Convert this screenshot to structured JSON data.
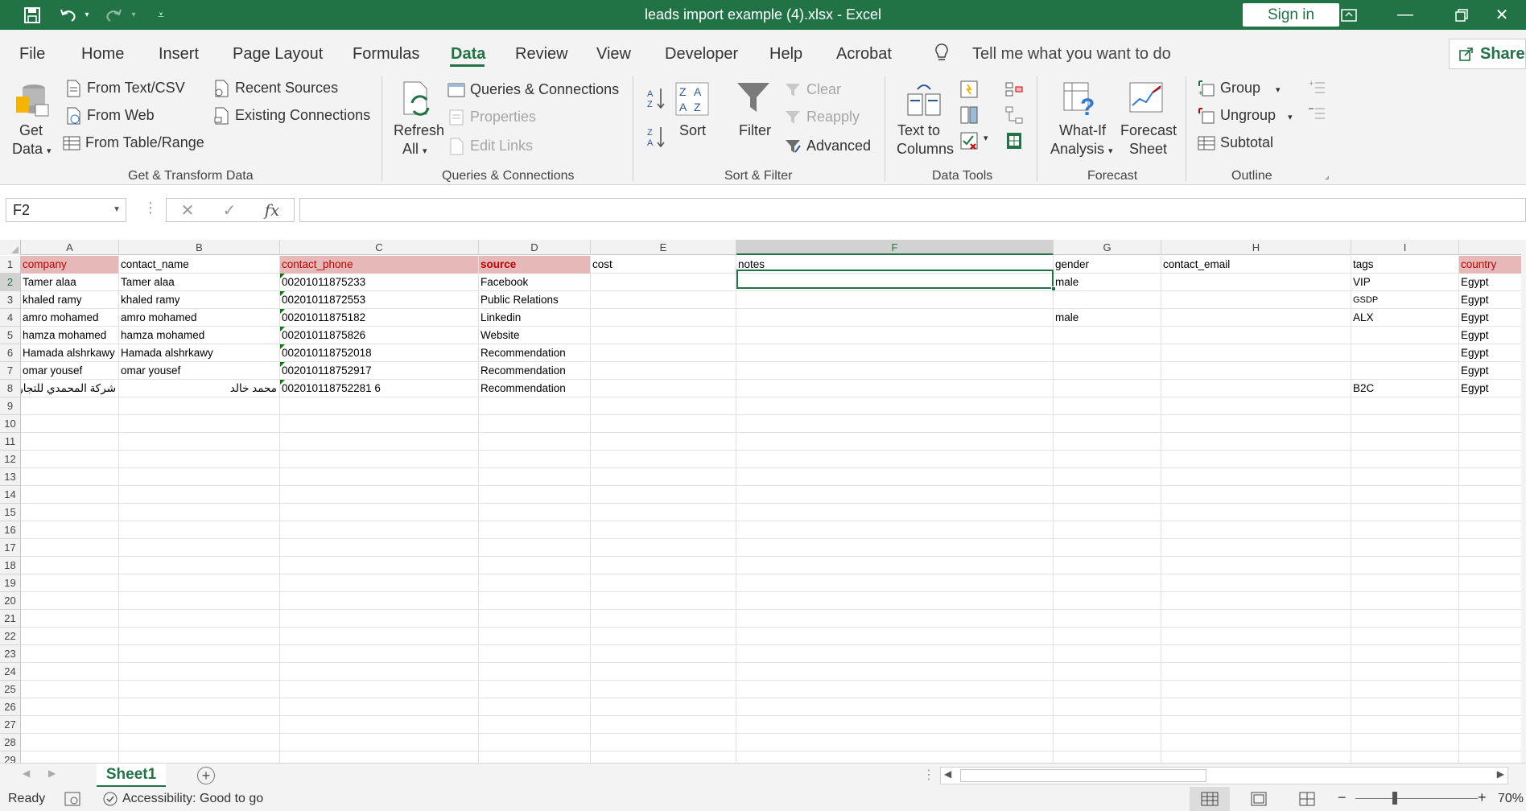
{
  "window": {
    "title": "leads import example (4).xlsx  -  Excel",
    "sign_in": "Sign in"
  },
  "tabs": [
    "File",
    "Home",
    "Insert",
    "Page Layout",
    "Formulas",
    "Data",
    "Review",
    "View",
    "Developer",
    "Help",
    "Acrobat"
  ],
  "active_tab": "Data",
  "tell_me": "Tell me what you want to do",
  "share": "Share",
  "ribbon": {
    "get_data_line1": "Get",
    "get_data_line2": "Data",
    "from_text_csv": "From Text/CSV",
    "from_web": "From Web",
    "from_table_range": "From Table/Range",
    "recent_sources": "Recent Sources",
    "existing_connections": "Existing Connections",
    "group_get_transform": "Get & Transform Data",
    "refresh_line1": "Refresh",
    "refresh_line2": "All",
    "queries_connections": "Queries & Connections",
    "properties": "Properties",
    "edit_links": "Edit Links",
    "group_queries": "Queries & Connections",
    "sort": "Sort",
    "filter": "Filter",
    "clear": "Clear",
    "reapply": "Reapply",
    "advanced": "Advanced",
    "group_sort_filter": "Sort & Filter",
    "text_to_columns_line1": "Text to",
    "text_to_columns_line2": "Columns",
    "group_data_tools": "Data Tools",
    "what_if_line1": "What-If",
    "what_if_line2": "Analysis",
    "forecast_sheet_line1": "Forecast",
    "forecast_sheet_line2": "Sheet",
    "group_forecast": "Forecast",
    "group": "Group",
    "ungroup": "Ungroup",
    "subtotal": "Subtotal",
    "group_outline": "Outline"
  },
  "formula_bar": {
    "name_box": "F2",
    "fx": "fx",
    "formula": ""
  },
  "columns": [
    "A",
    "B",
    "C",
    "D",
    "E",
    "F",
    "G",
    "H",
    "I"
  ],
  "selected_column": "F",
  "selected_row": "2",
  "rows": [
    "1",
    "2",
    "3",
    "4",
    "5",
    "6",
    "7",
    "8",
    "9",
    "10",
    "11",
    "12",
    "13",
    "14",
    "15",
    "16",
    "17",
    "18",
    "19",
    "20",
    "21",
    "22",
    "23",
    "24",
    "25",
    "26",
    "27",
    "28",
    "29"
  ],
  "header_row": {
    "A": "company",
    "B": "contact_name",
    "C": "contact_phone",
    "D": "source",
    "E": "cost",
    "F": "notes",
    "G": "gender",
    "H": "contact_email",
    "I": "tags",
    "J": "country"
  },
  "data_rows": [
    {
      "A": "Tamer alaa",
      "B": "Tamer alaa",
      "C": "00201011875233",
      "D": "Facebook",
      "G": "male",
      "I": "VIP",
      "J": "Egypt"
    },
    {
      "A": "khaled ramy",
      "B": "khaled ramy",
      "C": "00201011872553",
      "D": "Public Relations",
      "G": "",
      "I": "GSDP",
      "J": "Egypt"
    },
    {
      "A": "amro mohamed",
      "B": "amro mohamed",
      "C": "00201011875182",
      "D": "Linkedin",
      "G": "male",
      "I": "ALX",
      "J": "Egypt"
    },
    {
      "A": "hamza mohamed",
      "B": "hamza mohamed",
      "C": "00201011875826",
      "D": "Website",
      "G": "",
      "I": "",
      "J": "Egypt"
    },
    {
      "A": "Hamada alshrkawy",
      "B": "Hamada alshrkawy",
      "C": "002010118752018",
      "D": "Recommendation",
      "G": "",
      "I": "",
      "J": "Egypt"
    },
    {
      "A": "omar yousef",
      "B": "omar yousef",
      "C": "002010118752917",
      "D": "Recommendation",
      "G": "",
      "I": "",
      "J": "Egypt"
    },
    {
      "A": "شركة المحمدي للتجارة",
      "B": "محمد خالد",
      "C": "002010118752281 6",
      "D": "Recommendation",
      "G": "",
      "I": "B2C",
      "J": "Egypt"
    }
  ],
  "sheet_tab": "Sheet1",
  "status": {
    "ready": "Ready",
    "accessibility": "Accessibility: Good to go",
    "zoom": "70%"
  }
}
